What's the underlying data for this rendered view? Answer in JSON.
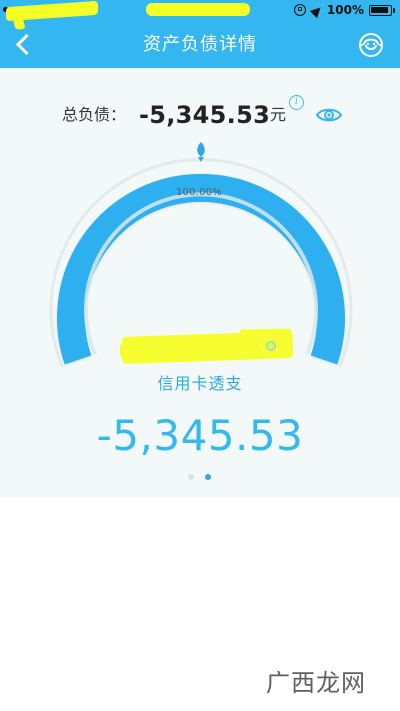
{
  "colors": {
    "header": "#34b6f0",
    "accent": "#33b8ef",
    "panel": "#f3f9f9",
    "redaction": "#f7ff2d"
  },
  "status_bar": {
    "battery_text": "100%"
  },
  "header": {
    "title": "资产负债详情",
    "back_icon": "chevron-left",
    "service_icon": "customer-service"
  },
  "summary": {
    "label": "总负债：",
    "amount": "-5,345.53",
    "unit": "元",
    "info_icon_text": "i",
    "visibility_icon": "eye"
  },
  "gauge": {
    "percent_text": "100.00%",
    "category": "信用卡透支",
    "amount": "-5,345.53"
  },
  "pager": {
    "active_index": 1,
    "count": 2
  },
  "watermark": {
    "text": "广西龙网"
  }
}
